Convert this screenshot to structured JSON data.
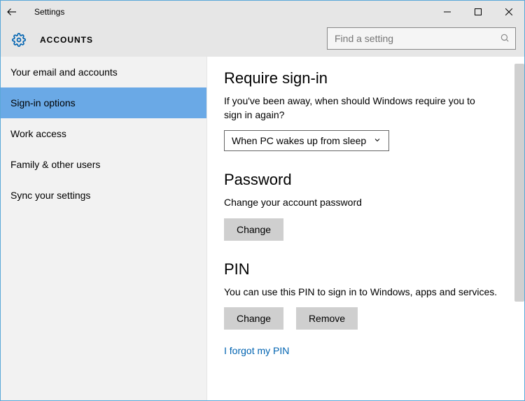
{
  "window": {
    "title": "Settings"
  },
  "header": {
    "section": "ACCOUNTS",
    "search_placeholder": "Find a setting"
  },
  "sidebar": {
    "items": [
      {
        "label": "Your email and accounts",
        "selected": false
      },
      {
        "label": "Sign-in options",
        "selected": true
      },
      {
        "label": "Work access",
        "selected": false
      },
      {
        "label": "Family & other users",
        "selected": false
      },
      {
        "label": "Sync your settings",
        "selected": false
      }
    ]
  },
  "content": {
    "require_signin": {
      "title": "Require sign-in",
      "desc": "If you've been away, when should Windows require you to sign in again?",
      "dropdown_value": "When PC wakes up from sleep"
    },
    "password": {
      "title": "Password",
      "desc": "Change your account password",
      "change_label": "Change"
    },
    "pin": {
      "title": "PIN",
      "desc": "You can use this PIN to sign in to Windows, apps and services.",
      "change_label": "Change",
      "remove_label": "Remove",
      "forgot_link": "I forgot my PIN"
    }
  }
}
